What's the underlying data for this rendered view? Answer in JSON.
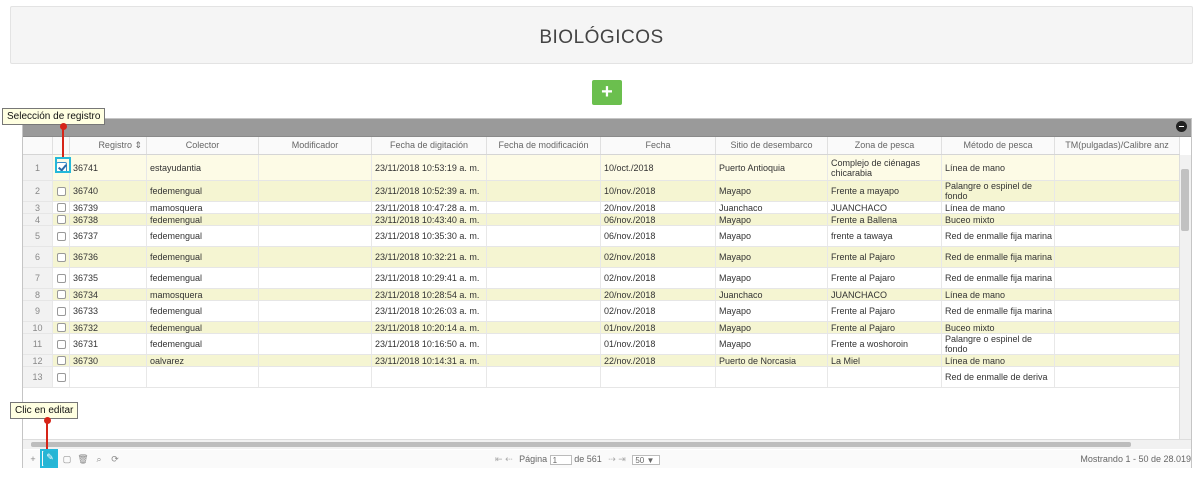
{
  "title": "BIOLÓGICOS",
  "add_button_label": "+",
  "columns": [
    "",
    "",
    "Registro ⇕",
    "Colector",
    "Modificador",
    "Fecha de digitación",
    "Fecha de modificación",
    "Fecha",
    "Sitio de desembarco",
    "Zona de pesca",
    "Método de pesca",
    "TM(pulgadas)/Calibre anz"
  ],
  "rows": [
    {
      "n": "1",
      "reg": "36741",
      "col": "estayudantia",
      "mod": "",
      "dig": "23/11/2018 10:53:19 a. m.",
      "fmod": "",
      "fecha": "10/oct./2018",
      "sitio": "Puerto Antioquia",
      "zona": "Complejo de ciénagas chicarabia",
      "metodo": "Línea de mano",
      "tm": ""
    },
    {
      "n": "2",
      "reg": "36740",
      "col": "fedemengual",
      "mod": "",
      "dig": "23/11/2018 10:52:39 a. m.",
      "fmod": "",
      "fecha": "10/nov./2018",
      "sitio": "Mayapo",
      "zona": "Frente a mayapo",
      "metodo": "Palangre o espinel de fondo",
      "tm": ""
    },
    {
      "n": "3",
      "reg": "36739",
      "col": "mamosquera",
      "mod": "",
      "dig": "23/11/2018 10:47:28 a. m.",
      "fmod": "",
      "fecha": "20/nov./2018",
      "sitio": "Juanchaco",
      "zona": "JUANCHACO",
      "metodo": "Línea de mano",
      "tm": ""
    },
    {
      "n": "4",
      "reg": "36738",
      "col": "fedemengual",
      "mod": "",
      "dig": "23/11/2018 10:43:40 a. m.",
      "fmod": "",
      "fecha": "06/nov./2018",
      "sitio": "Mayapo",
      "zona": "Frente a Ballena",
      "metodo": "Buceo mixto",
      "tm": ""
    },
    {
      "n": "5",
      "reg": "36737",
      "col": "fedemengual",
      "mod": "",
      "dig": "23/11/2018 10:35:30 a. m.",
      "fmod": "",
      "fecha": "06/nov./2018",
      "sitio": "Mayapo",
      "zona": "frente a tawaya",
      "metodo": "Red de enmalle fija marina",
      "tm": ""
    },
    {
      "n": "6",
      "reg": "36736",
      "col": "fedemengual",
      "mod": "",
      "dig": "23/11/2018 10:32:21 a. m.",
      "fmod": "",
      "fecha": "02/nov./2018",
      "sitio": "Mayapo",
      "zona": "Frente al Pajaro",
      "metodo": "Red de enmalle fija marina",
      "tm": ""
    },
    {
      "n": "7",
      "reg": "36735",
      "col": "fedemengual",
      "mod": "",
      "dig": "23/11/2018 10:29:41 a. m.",
      "fmod": "",
      "fecha": "02/nov./2018",
      "sitio": "Mayapo",
      "zona": "Frente al Pajaro",
      "metodo": "Red de enmalle fija marina",
      "tm": ""
    },
    {
      "n": "8",
      "reg": "36734",
      "col": "mamosquera",
      "mod": "",
      "dig": "23/11/2018 10:28:54 a. m.",
      "fmod": "",
      "fecha": "20/nov./2018",
      "sitio": "Juanchaco",
      "zona": "JUANCHACO",
      "metodo": "Línea de mano",
      "tm": ""
    },
    {
      "n": "9",
      "reg": "36733",
      "col": "fedemengual",
      "mod": "",
      "dig": "23/11/2018 10:26:03 a. m.",
      "fmod": "",
      "fecha": "02/nov./2018",
      "sitio": "Mayapo",
      "zona": "Frente al Pajaro",
      "metodo": "Red de enmalle fija marina",
      "tm": ""
    },
    {
      "n": "10",
      "reg": "36732",
      "col": "fedemengual",
      "mod": "",
      "dig": "23/11/2018 10:20:14 a. m.",
      "fmod": "",
      "fecha": "01/nov./2018",
      "sitio": "Mayapo",
      "zona": "Frente al Pajaro",
      "metodo": "Buceo mixto",
      "tm": ""
    },
    {
      "n": "11",
      "reg": "36731",
      "col": "fedemengual",
      "mod": "",
      "dig": "23/11/2018 10:16:50 a. m.",
      "fmod": "",
      "fecha": "01/nov./2018",
      "sitio": "Mayapo",
      "zona": "Frente a woshoroin",
      "metodo": "Palangre o espinel de fondo",
      "tm": ""
    },
    {
      "n": "12",
      "reg": "36730",
      "col": "oalvarez",
      "mod": "",
      "dig": "23/11/2018 10:14:31 a. m.",
      "fmod": "",
      "fecha": "22/nov./2018",
      "sitio": "Puerto de Norcasia",
      "zona": "La Miel",
      "metodo": "Línea de mano",
      "tm": ""
    },
    {
      "n": "13",
      "reg": "",
      "col": "",
      "mod": "",
      "dig": "",
      "fmod": "",
      "fecha": "",
      "sitio": "",
      "zona": "",
      "metodo": "Red de enmalle de deriva",
      "tm": ""
    }
  ],
  "pager": {
    "page_label": "Página",
    "page_value": "1",
    "of_label": "de 561",
    "page_size": "50 ▼",
    "info": "Mostrando 1 - 50 de 28.019",
    "nav_first": "⇤",
    "nav_prev": "⇠",
    "nav_next": "⇢",
    "nav_last": "⇥"
  },
  "toolbar_icons": {
    "add": "+",
    "edit": "✎",
    "view": "▢",
    "delete": "🗑",
    "search": "⌕",
    "refresh": "⟳"
  },
  "tooltips": {
    "seleccion": "Selección de registro",
    "editar": "Clic en editar"
  },
  "colors": {
    "add_button": "#6bbf4e",
    "alt_row": "#f5f5d2",
    "highlight": "#25b8da",
    "pin": "#d62518"
  }
}
